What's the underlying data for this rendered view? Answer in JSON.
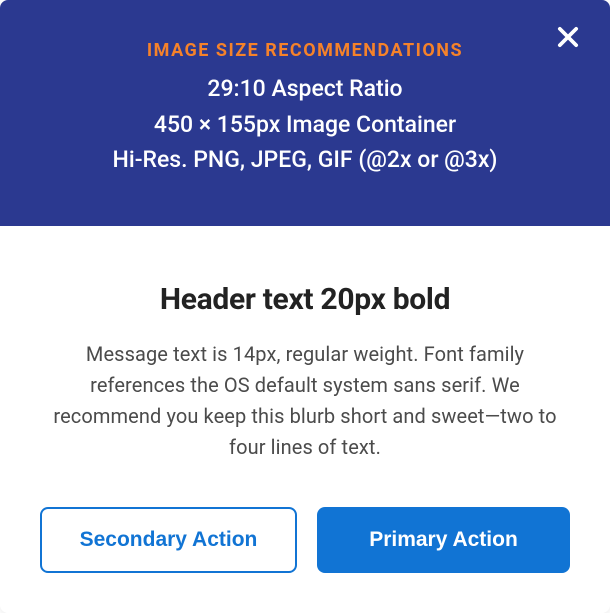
{
  "banner": {
    "label": "IMAGE SIZE RECOMMENDATIONS",
    "line1": "29:10 Aspect Ratio",
    "line2": "450 × 155px Image Container",
    "line3": "Hi-Res. PNG, JPEG, GIF (@2x or @3x)"
  },
  "content": {
    "header": "Header text 20px bold",
    "message": "Message text is 14px, regular weight. Font family references the OS default system sans serif. We recommend you keep this blurb short and sweet—two to four lines of text."
  },
  "buttons": {
    "secondary": "Secondary Action",
    "primary": "Primary Action"
  },
  "colors": {
    "banner_bg": "#2b3990",
    "accent_orange": "#f5822a",
    "primary_blue": "#1174d4"
  }
}
